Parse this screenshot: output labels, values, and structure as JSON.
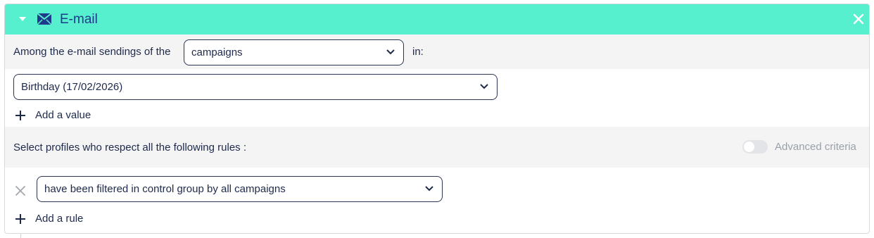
{
  "colors": {
    "header_bg": "#56f0cf",
    "text": "#1e2a4a",
    "title": "#1e3a8a",
    "muted": "#9aa0aa"
  },
  "header": {
    "title": "E-mail",
    "icon": "mail-icon"
  },
  "sending_row": {
    "label_before": "Among the e-mail sendings of the",
    "select_value": "campaigns",
    "label_after": "in:"
  },
  "values": {
    "select_value": "Birthday (17/02/2026)",
    "add_label": "Add a value"
  },
  "rules": {
    "label": "Select profiles who respect all the following rules :",
    "advanced_label": "Advanced criteria",
    "advanced_enabled": false,
    "rule_value": "have been filtered in control group by all campaigns",
    "add_label": "Add a rule"
  }
}
